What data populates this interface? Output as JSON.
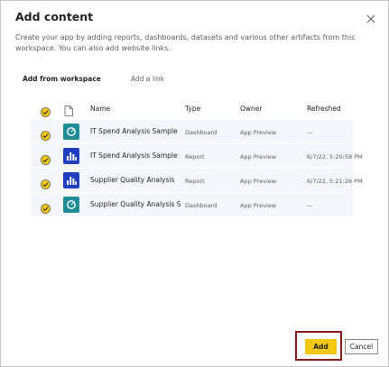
{
  "dialog": {
    "title": "Add content",
    "description": "Create your app by adding reports, dashboards, datasets and various other artifacts from this workspace. You can also add website links."
  },
  "tabs": [
    {
      "label": "Add from workspace",
      "active": true
    },
    {
      "label": "Add a link",
      "active": false
    }
  ],
  "table": {
    "columns": [
      "Name",
      "Type",
      "Owner",
      "Refreshed"
    ],
    "rows": [
      {
        "name": "IT Spend Analysis Sample",
        "type": "Dashboard",
        "owner": "App Preview",
        "refreshed": "—",
        "icon": "dashboard-icon",
        "checked": true
      },
      {
        "name": "IT Spend Analysis Sample",
        "type": "Report",
        "owner": "App Preview",
        "refreshed": "6/7/22, 5:20:58 PM",
        "icon": "report-icon",
        "checked": true
      },
      {
        "name": "Supplier Quality Analysis",
        "type": "Report",
        "owner": "App Preview",
        "refreshed": "6/7/22, 5:21:26 PM",
        "icon": "report-icon",
        "checked": true
      },
      {
        "name": "Supplier Quality Analysis S...",
        "type": "Dashboard",
        "owner": "App Preview",
        "refreshed": "—",
        "icon": "dashboard-icon",
        "checked": true
      }
    ]
  },
  "buttons": {
    "add": "Add",
    "cancel": "Cancel"
  },
  "colors": {
    "accent": "#f2c811",
    "check": "#f2c811",
    "dashboard_tile": "#1e8d98",
    "report_tile": "#1f3fbf",
    "row_bg": "#f3f7fc",
    "highlight_border": "#8b1a1a"
  }
}
